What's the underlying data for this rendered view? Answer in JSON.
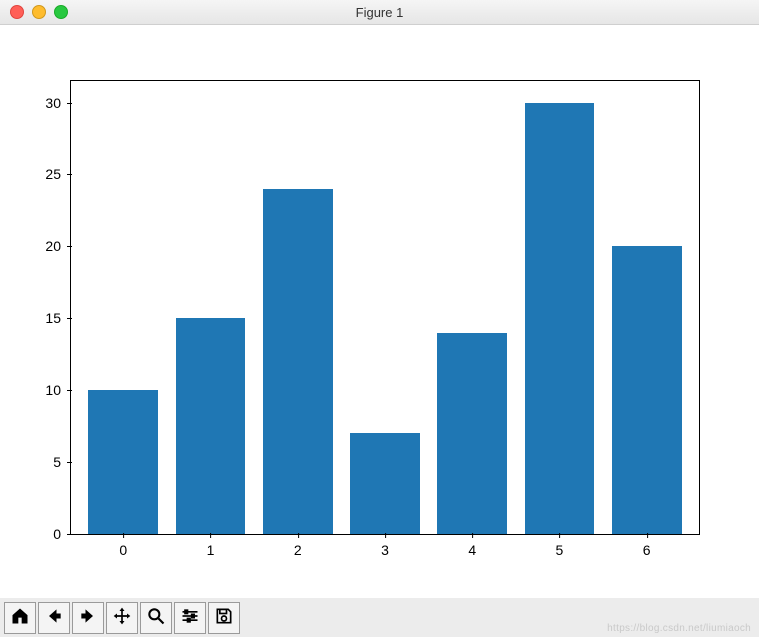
{
  "window": {
    "title": "Figure 1"
  },
  "chart_data": {
    "type": "bar",
    "categories": [
      "0",
      "1",
      "2",
      "3",
      "4",
      "5",
      "6"
    ],
    "values": [
      10,
      15,
      24,
      7,
      14,
      30,
      20
    ],
    "yticks": [
      0,
      5,
      10,
      15,
      20,
      25,
      30
    ],
    "ylim": [
      0,
      31.5
    ],
    "xlim": [
      -0.6,
      6.6
    ],
    "bar_color": "#1f77b4",
    "title": "",
    "xlabel": "",
    "ylabel": ""
  },
  "toolbar": {
    "buttons": [
      {
        "name": "home-icon"
      },
      {
        "name": "back-icon"
      },
      {
        "name": "forward-icon"
      },
      {
        "name": "pan-icon"
      },
      {
        "name": "zoom-icon"
      },
      {
        "name": "configure-icon"
      },
      {
        "name": "save-icon"
      }
    ]
  },
  "watermark": "https://blog.csdn.net/liumiaoch"
}
